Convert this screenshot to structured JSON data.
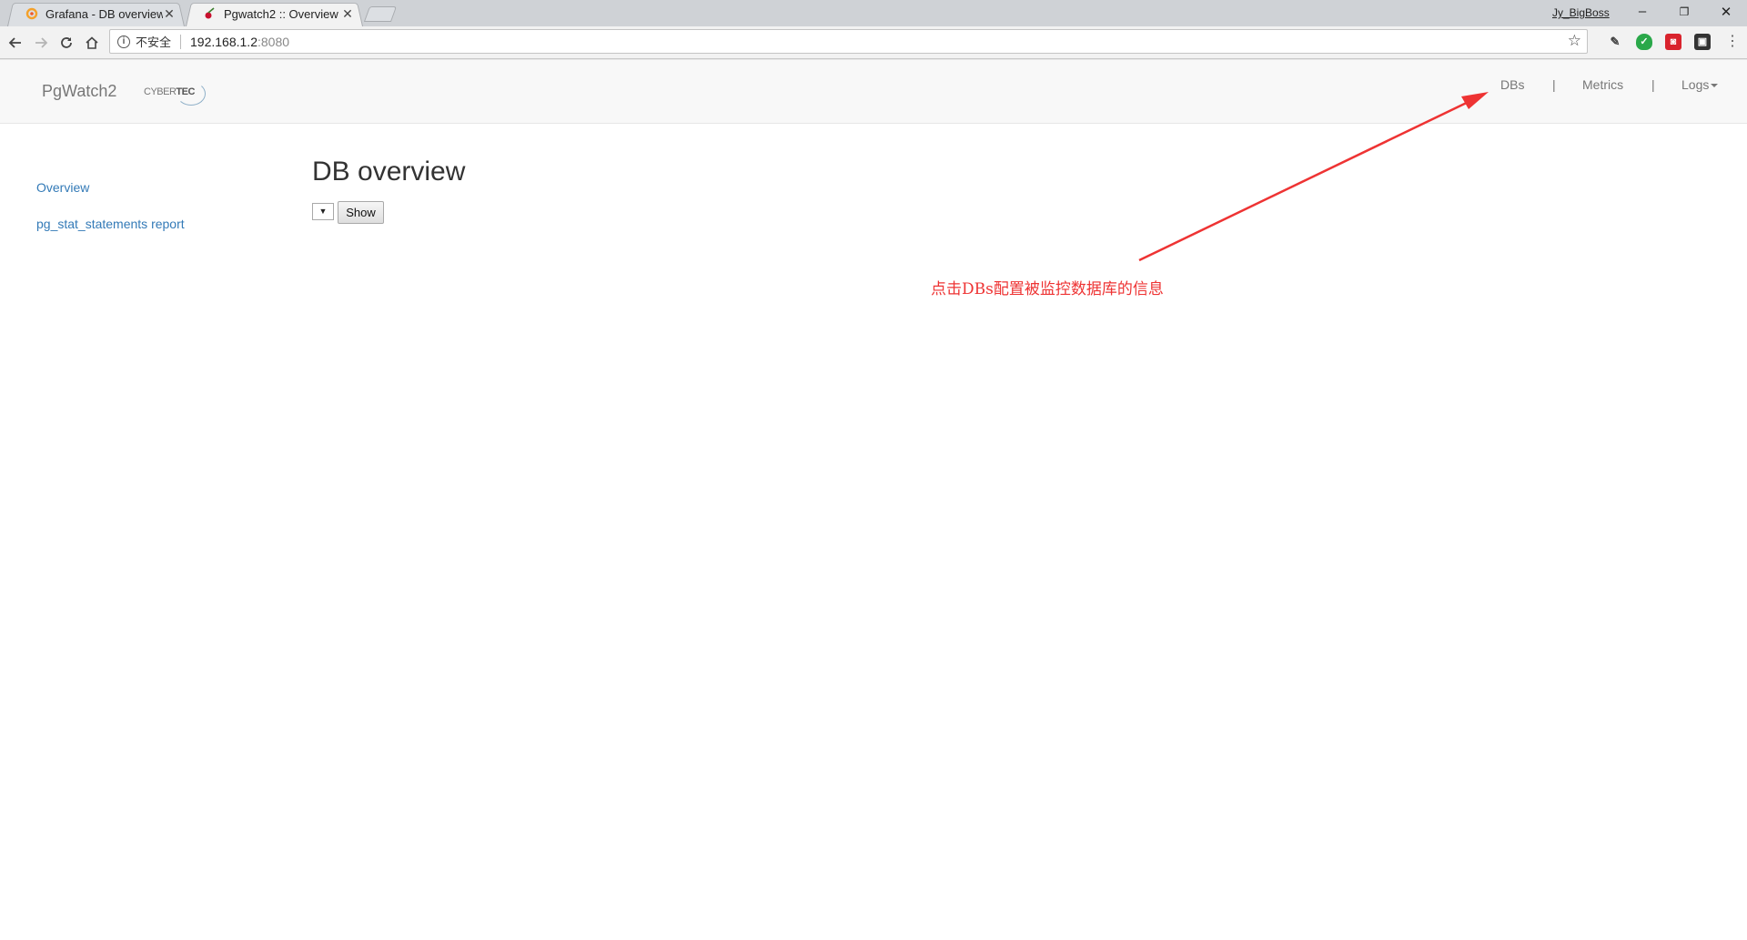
{
  "browser": {
    "tabs": [
      {
        "title": "Grafana - DB overview",
        "active": false
      },
      {
        "title": "Pgwatch2 :: Overview",
        "active": true
      }
    ],
    "profile_name": "Jy_BigBoss",
    "window_controls": {
      "minimize": "–",
      "restore": "❐",
      "close": "✕"
    },
    "url": {
      "security_label": "不安全",
      "host": "192.168.1.2",
      "port": ":8080"
    }
  },
  "navbar": {
    "brand": "PgWatch2",
    "logo_text_light": "CYBER",
    "logo_text_bold": "TEC",
    "links": {
      "dbs": "DBs",
      "metrics": "Metrics",
      "logs": "Logs"
    },
    "separator": "|"
  },
  "sidebar": {
    "items": [
      {
        "label": "Overview"
      },
      {
        "label": "pg_stat_statements report"
      }
    ]
  },
  "main": {
    "title": "DB overview",
    "select_value": "▼",
    "show_button": "Show"
  },
  "annotation": {
    "text": "点击DBs配置被监控数据库的信息",
    "color": "#ee3333"
  },
  "colors": {
    "link": "#337ab7",
    "navbar_bg": "#f8f8f8",
    "nav_text": "#777777"
  }
}
